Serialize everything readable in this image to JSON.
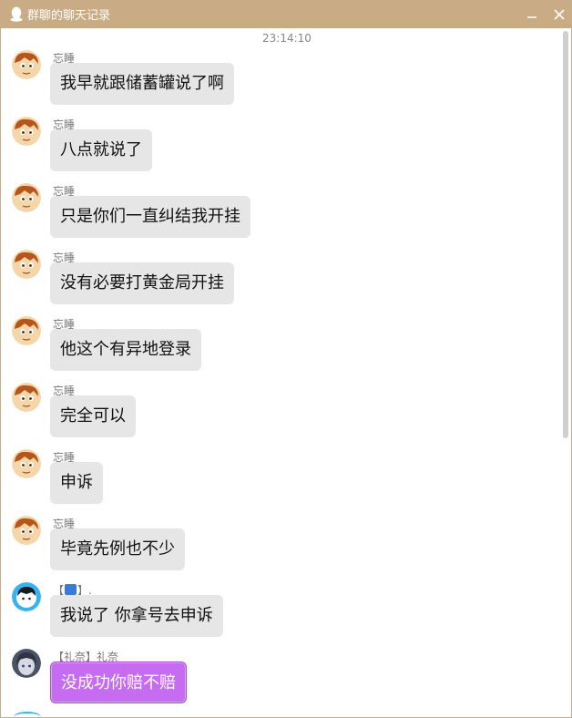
{
  "window": {
    "title": "群聊的聊天记录"
  },
  "titlebar": {
    "minimize_glyph": "−",
    "close_glyph": "✕"
  },
  "timestamp": "23:14:10",
  "colors": {
    "titlebar": "#c9ab86",
    "bubble": "#e6e6e6",
    "highlight_bubble": "#c56cf0"
  },
  "messages": [
    {
      "sender": "忘睡",
      "text": "我早就跟储蓄罐说了啊",
      "avatar": "cartoon-boy-avatar"
    },
    {
      "sender": "忘睡",
      "text": "八点就说了",
      "avatar": "cartoon-boy-avatar"
    },
    {
      "sender": "忘睡",
      "text": "只是你们一直纠结我开挂",
      "avatar": "cartoon-boy-avatar"
    },
    {
      "sender": "忘睡",
      "text": "没有必要打黄金局开挂",
      "avatar": "cartoon-boy-avatar"
    },
    {
      "sender": "忘睡",
      "text": "他这个有异地登录",
      "avatar": "cartoon-boy-avatar"
    },
    {
      "sender": "忘睡",
      "text": "完全可以",
      "avatar": "cartoon-boy-avatar"
    },
    {
      "sender": "忘睡",
      "text": "申诉",
      "avatar": "cartoon-boy-avatar"
    },
    {
      "sender": "忘睡",
      "text": "毕竟先例也不少",
      "avatar": "cartoon-boy-avatar"
    },
    {
      "sender_prefix": "【",
      "sender_suffix": "】.",
      "text": "我说了 你拿号去申诉",
      "avatar": "anime-avatar-blue"
    },
    {
      "sender": "【礼奈】礼奈",
      "text": "没成功你赔不赔",
      "avatar": "anime-avatar-dark",
      "style": "purple"
    }
  ]
}
